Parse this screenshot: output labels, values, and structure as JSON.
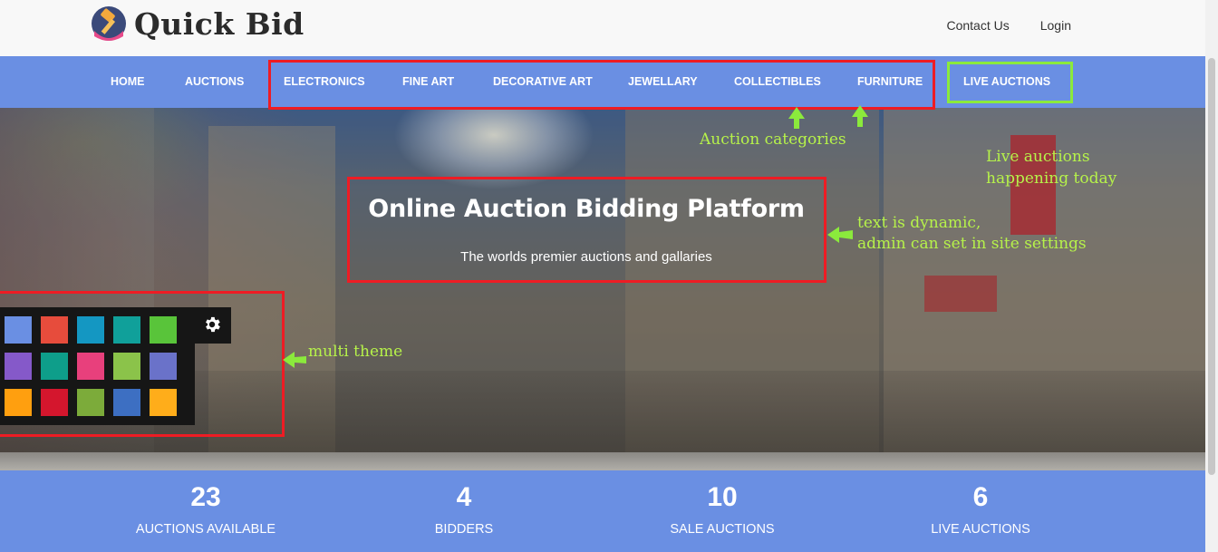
{
  "header": {
    "brand": "Quick Bid",
    "links": [
      "Contact Us",
      "Login"
    ]
  },
  "nav": {
    "items": [
      "HOME",
      "AUCTIONS",
      "ELECTRONICS",
      "FINE ART",
      "DECORATIVE ART",
      "JEWELLARY",
      "COLLECTIBLES",
      "FURNITURE",
      "LIVE AUCTIONS"
    ]
  },
  "hero": {
    "title": "Online Auction Bidding Platform",
    "subtitle": "The worlds premier auctions and gallaries"
  },
  "theme_palette": {
    "icon": "gear-icon",
    "colors": [
      "#6a8fe3",
      "#e74c3c",
      "#1497c2",
      "#10a09a",
      "#59c43a",
      "#8559c9",
      "#0e9e8a",
      "#e8407c",
      "#8bc34a",
      "#6a72c9",
      "#ff9f0f",
      "#d4162d",
      "#7cab3a",
      "#3d6fc2",
      "#ffad1a"
    ]
  },
  "annotations": {
    "categories": "Auction categories",
    "live_line1": "Live auctions",
    "live_line2": "happening today",
    "dynamic_line1": "text is dynamic,",
    "dynamic_line2": "admin can set in site settings",
    "theme": "multi theme"
  },
  "stats": [
    {
      "value": "23",
      "label": "AUCTIONS AVAILABLE"
    },
    {
      "value": "4",
      "label": "BIDDERS"
    },
    {
      "value": "10",
      "label": "SALE AUCTIONS"
    },
    {
      "value": "6",
      "label": "LIVE AUCTIONS"
    }
  ],
  "colors": {
    "primary": "#6a8fe3",
    "annotation_red": "#ee1c24",
    "annotation_green": "#8bea3c",
    "annotation_text": "#b6f24a"
  }
}
